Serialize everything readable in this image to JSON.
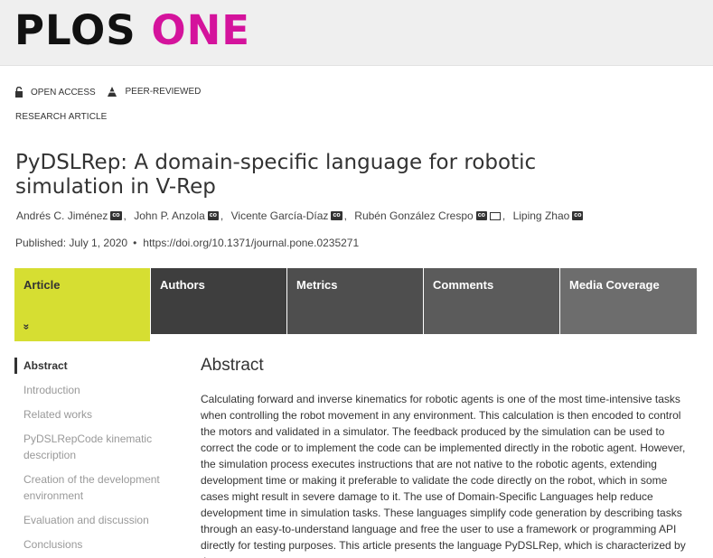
{
  "logo": {
    "part1": "PLOS",
    "part2": "ONE",
    "brand_color": "#d4139c"
  },
  "badges": [
    {
      "label": "OPEN ACCESS",
      "icon": "open-lock-icon"
    },
    {
      "label": "PEER-REVIEWED",
      "icon": "peer-review-icon"
    }
  ],
  "article_type": "RESEARCH ARTICLE",
  "title": "PyDSLRep: A domain-specific language for robotic simulation in V-Rep",
  "authors": [
    {
      "name": "Andrés C. Jiménez"
    },
    {
      "name": "John P. Anzola"
    },
    {
      "name": "Vicente García-Díaz"
    },
    {
      "name": "Rubén González Crespo"
    },
    {
      "name": "Liping Zhao"
    }
  ],
  "orcid_badge": "co",
  "published": "Published: July 1, 2020",
  "bullet": "•",
  "doi": "https://doi.org/10.1371/journal.pone.0235271",
  "tabs": [
    {
      "label": "Article"
    },
    {
      "label": "Authors"
    },
    {
      "label": "Metrics"
    },
    {
      "label": "Comments"
    },
    {
      "label": "Media Coverage"
    }
  ],
  "active_tab_chevron": "»",
  "sidebar": {
    "items": [
      {
        "label": "Abstract"
      },
      {
        "label": "Introduction"
      },
      {
        "label": "Related works"
      },
      {
        "label": "PyDSLRepCode kinematic description"
      },
      {
        "label": "Creation of the development environment"
      },
      {
        "label": "Evaluation and discussion"
      },
      {
        "label": "Conclusions"
      }
    ]
  },
  "main": {
    "heading": "Abstract",
    "text": "Calculating forward and inverse kinematics for robotic agents is one of the most time-intensive tasks when controlling the robot movement in any environment. This calculation is then encoded to control the motors and validated in a simulator. The feedback produced by the simulation can be used to correct the code or to implement the code can be implemented directly in the robotic agent. However, the simulation process executes instructions that are not native to the robotic agents, extending development time or making it preferable to validate the code directly on the robot, which in some cases might result in severe damage to it. The use of Domain-Specific Languages help reduce development time in simulation tasks. These languages simplify code generation by describing tasks through an easy-to-understand language and free the user to use a framework or programming API directly for testing purposes. This article presents the language PyDSLRep, which is characterized by the"
  }
}
